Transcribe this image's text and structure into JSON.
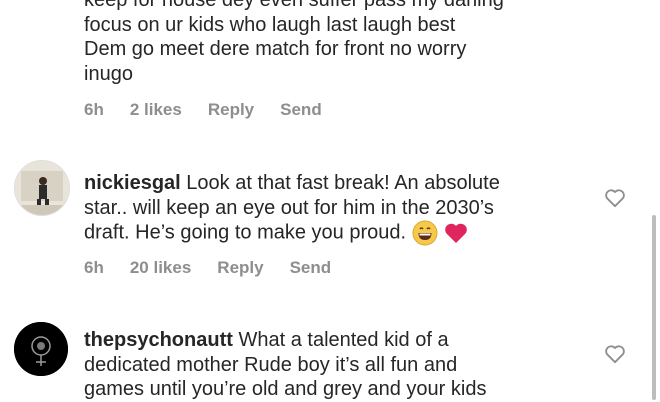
{
  "comments": [
    {
      "id": "c1",
      "partial_top_line": "keep for house dey even suffer pass my darling",
      "lines": [
        "focus on ur kids who laugh last laugh best",
        "Dem go meet dere match for front no worry",
        "inugo"
      ],
      "time": "6h",
      "likes": "2 likes",
      "reply": "Reply",
      "send": "Send"
    },
    {
      "id": "c2",
      "username": "nickiesgal",
      "text_line1": "Look at that fast break! An absolute",
      "text_line2": "star.. will keep an eye out for him in the 2030’s",
      "text_line3": "draft. He’s going to make you proud.",
      "emojis": [
        "grinning-face",
        "red-heart"
      ],
      "time": "6h",
      "likes": "20 likes",
      "reply": "Reply",
      "send": "Send"
    },
    {
      "id": "c3",
      "username": "thepsychonautt",
      "text_line1": "What a talented kid of a",
      "text_line2": "dedicated mother  Rude boy it’s all fun and",
      "text_line3": "games until you’re old and grey and your kids"
    }
  ],
  "icons": {
    "like": "heart-outline-icon"
  },
  "colors": {
    "text": "#262626",
    "meta": "#8e8e8e",
    "heart_emoji": "#e0245e",
    "grin_emoji": "#f7c948"
  }
}
